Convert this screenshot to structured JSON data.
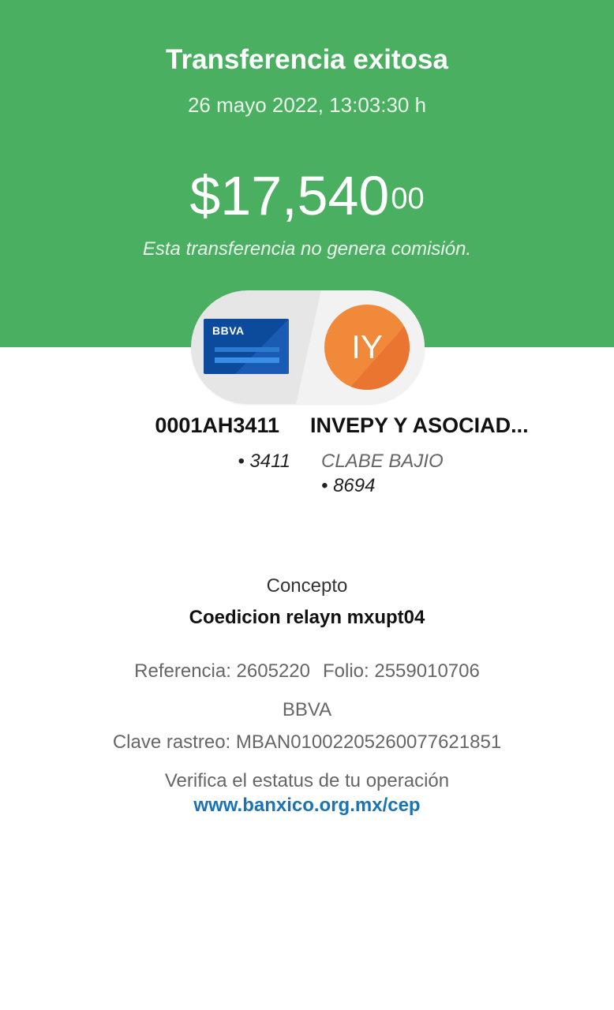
{
  "header": {
    "title": "Transferencia exitosa",
    "datetime": "26 mayo 2022, 13:03:30 h",
    "amount_main": "$17,540",
    "amount_cents": "00",
    "fee_note": "Esta transferencia no genera comisión."
  },
  "colors": {
    "header_bg": "#4baf62",
    "avatar_bg": "#f08a3a",
    "card_bg": "#0c4a9c",
    "link": "#1a73b5"
  },
  "origin": {
    "card_brand": "BBVA",
    "name": "0001AH3411",
    "account": "• 3411"
  },
  "destination": {
    "initials": "IY",
    "name": "INVEPY Y ASOCIAD...",
    "account_type": "CLABE BAJIO",
    "account": "• 8694"
  },
  "details": {
    "concept_label": "Concepto",
    "concept_value": "Coedicion relayn mxupt04",
    "reference": "Referencia: 2605220",
    "folio": "Folio: 2559010706",
    "bank": "BBVA",
    "tracking_key": "Clave rastreo: MBAN01002205260077621851",
    "verify_text": "Verifica el estatus de tu operación",
    "verify_link": "www.banxico.org.mx/cep"
  }
}
